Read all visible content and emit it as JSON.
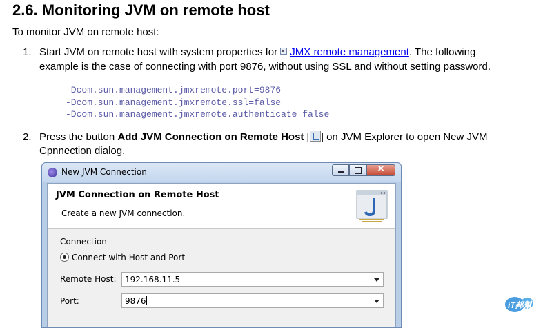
{
  "section": {
    "heading": "2.6. Monitoring JVM on remote host",
    "intro": "To monitor JVM on remote host:"
  },
  "step1": {
    "number": "1.",
    "text_before": "Start JVM on remote host with system properties for ",
    "link": "JMX remote management",
    "text_after_line1": ". The following",
    "line2": "example is the case of connecting with port 9876, without using SSL and without setting password."
  },
  "code_lines": [
    "-Dcom.sun.management.jmxremote.port=9876",
    "-Dcom.sun.management.jmxremote.ssl=false",
    "-Dcom.sun.management.jmxremote.authenticate=false"
  ],
  "step2": {
    "number": "2.",
    "text_before": "Press the button ",
    "bold": "Add JVM Connection on Remote Host",
    "bracket_open": " [",
    "bracket_close": "]",
    "text_after": " on JVM Explorer to open New JVM",
    "line2": "Cpnnection dialog."
  },
  "dialog": {
    "title": "New JVM Connection",
    "header_title": "JVM Connection on Remote Host",
    "header_desc": "Create a new JVM connection.",
    "group_label": "Connection",
    "radio_label": "Connect with Host and Port",
    "remote_host_label": "Remote Host:",
    "remote_host_value": "192.168.11.5",
    "port_label": "Port:",
    "port_value": "9876"
  },
  "watermark": {
    "text": "iT邦幫忙"
  },
  "colors": {
    "link": "#0000ee",
    "code": "#5a5aa6",
    "dialog_frame": "#b8cde6"
  }
}
